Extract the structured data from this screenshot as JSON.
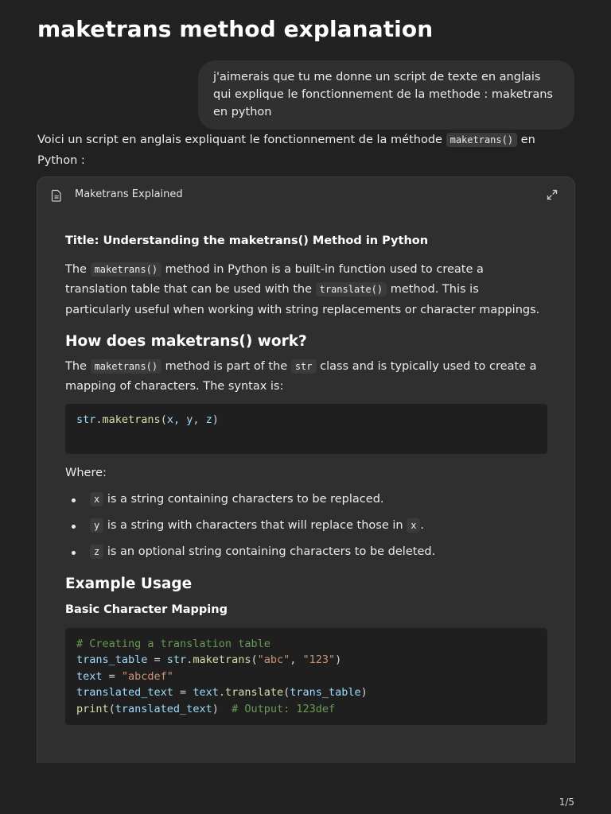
{
  "page": {
    "title": "maketrans method explanation"
  },
  "user_message": "j'aimerais que tu me donne un script de texte en anglais qui explique le fonctionnement de la methode : maketrans en python",
  "assistant": {
    "intro_before": "Voici un script en anglais expliquant le fonctionnement de la méthode ",
    "intro_code": "maketrans()",
    "intro_after": " en Python :"
  },
  "canvas": {
    "title": "Maketrans Explained",
    "icons": {
      "document": "document-icon",
      "expand": "expand-icon"
    },
    "doc": {
      "title_line": "Title: Understanding the maketrans() Method in Python",
      "p1": {
        "a": "The ",
        "code1": "maketrans()",
        "b": " method in Python is a built-in function used to create a translation table that can be used with the ",
        "code2": "translate()",
        "c": " method. This is particularly useful when working with string replacements or character mappings."
      },
      "h2_how": "How does maketrans() work?",
      "p2": {
        "a": "The ",
        "code1": "maketrans()",
        "b": " method is part of the ",
        "code2": "str",
        "c": " class and is typically used to create a mapping of characters. The syntax is:"
      },
      "syntax_code": {
        "obj": "str",
        "dot": ".",
        "fn": "maketrans",
        "open": "(",
        "x": "x",
        "sep1": ", ",
        "y": "y",
        "sep2": ", ",
        "z": "z",
        "close": ")"
      },
      "where": "Where:",
      "bullets": [
        {
          "code": "x",
          "text": " is a string containing characters to be replaced."
        },
        {
          "code": "y",
          "text": " is a string with characters that will replace those in ",
          "code2": "x",
          "tail": "."
        },
        {
          "code": "z",
          "text": " is an optional string containing characters to be deleted."
        }
      ],
      "h2_example": "Example Usage",
      "h3_basic": "Basic Character Mapping",
      "example_code": {
        "comment1": "# Creating a translation table",
        "l2_var": "trans_table",
        "l2_eq": " = ",
        "l2_obj": "str",
        "l2_dot": ".",
        "l2_fn": "maketrans",
        "l2_open": "(",
        "l2_s1": "\"abc\"",
        "l2_sep": ", ",
        "l2_s2": "\"123\"",
        "l2_close": ")",
        "l3_var": "text",
        "l3_eq": " = ",
        "l3_s": "\"abcdef\"",
        "l4_var": "translated_text",
        "l4_eq": " = ",
        "l4_obj": "text",
        "l4_dot": ".",
        "l4_fn": "translate",
        "l4_open": "(",
        "l4_arg": "trans_table",
        "l4_close": ")",
        "l5_fn": "print",
        "l5_open": "(",
        "l5_arg": "translated_text",
        "l5_close": ")",
        "l5_pad": "  ",
        "l5_comment": "# Output: 123def"
      }
    }
  },
  "pager": "1/5",
  "colors": {
    "background": "#212121",
    "bubble": "#303030",
    "canvas": "#2f2f2f",
    "code_bg": "#1f1f1f",
    "comment": "#6a9955",
    "string": "#ce9178",
    "variable": "#9cdcfe",
    "function": "#dcdcaa"
  }
}
